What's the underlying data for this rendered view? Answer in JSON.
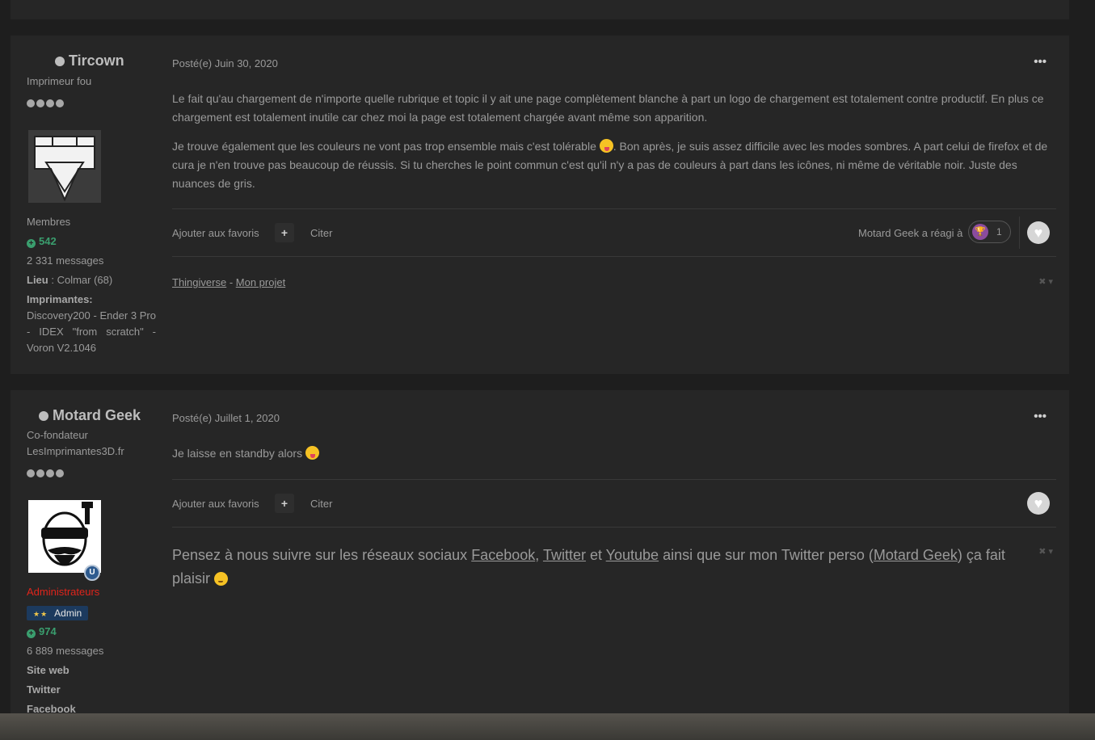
{
  "posts": [
    {
      "author": {
        "name": "Tircown",
        "title": "Imprimeur fou",
        "group": "Membres",
        "reputation": "542",
        "messages": "2 331 messages",
        "location_label": "Lieu",
        "location_value": " : Colmar (68)",
        "printers_label": "Imprimantes:",
        "printers_value": "Discovery200 - Ender 3 Pro - IDEX \"from scratch\" - Voron V2.1046"
      },
      "date": "Posté(e) Juin 30, 2020",
      "paragraph1": "Le fait qu'au chargement de n'importe quelle rubrique et topic il y ait une page complètement blanche à part un logo de chargement est totalement contre productif. En plus ce chargement est totalement inutile car chez moi la page est totalement chargée avant même son apparition.",
      "paragraph2_a": "Je trouve également que les couleurs ne vont pas trop ensemble mais c'est tolérable ",
      "paragraph2_b": ". Bon après, je suis assez difficile avec les modes sombres. A part celui de firefox et de cura je n'en trouve pas beaucoup de réussis. Si tu cherches le point commun c'est qu'il n'y a pas de couleurs à part dans les icônes, ni même de véritable noir. Juste des nuances de gris.",
      "favorite_label": "Ajouter aux favoris",
      "quote_label": "Citer",
      "reacted_text": "Motard Geek a réagi à",
      "reaction_count": "1",
      "sig_link1": "Thingiverse",
      "sig_sep": " - ",
      "sig_link2": "Mon projet"
    },
    {
      "author": {
        "name": "Motard Geek",
        "title_line1": "Co-fondateur",
        "title_line2": "LesImprimantes3D.fr",
        "group": "Administrateurs",
        "badge": "Admin",
        "reputation": "974",
        "messages": "6 889 messages",
        "link1": "Site web",
        "link2": "Twitter",
        "link3": "Facebook"
      },
      "date": "Posté(e) Juillet 1, 2020",
      "body": "Je laisse en standby alors ",
      "favorite_label": "Ajouter aux favoris",
      "quote_label": "Citer",
      "sig_text1": "Pensez à nous suivre sur les réseaux sociaux ",
      "sig_facebook": "Facebook",
      "sig_comma": ", ",
      "sig_twitter": "Twitter",
      "sig_et": " et ",
      "sig_youtube": "Youtube",
      "sig_text2": " ainsi que sur mon Twitter perso (",
      "sig_motard": "Motard Geek",
      "sig_text3": ") ça fait plaisir "
    }
  ],
  "icons": {
    "more": "ellipsis-icon",
    "plus": "plus-icon",
    "heart": "heart-icon",
    "trophy": "trophy-icon",
    "sig_close": "close-icon"
  },
  "colors": {
    "background": "#1e1e1e",
    "panel": "#262626",
    "reputation": "#3a9e6e",
    "admin_group": "#e0241b",
    "admin_badge": "#1c3a5e",
    "reaction_trophy": "#8b4b9e"
  }
}
